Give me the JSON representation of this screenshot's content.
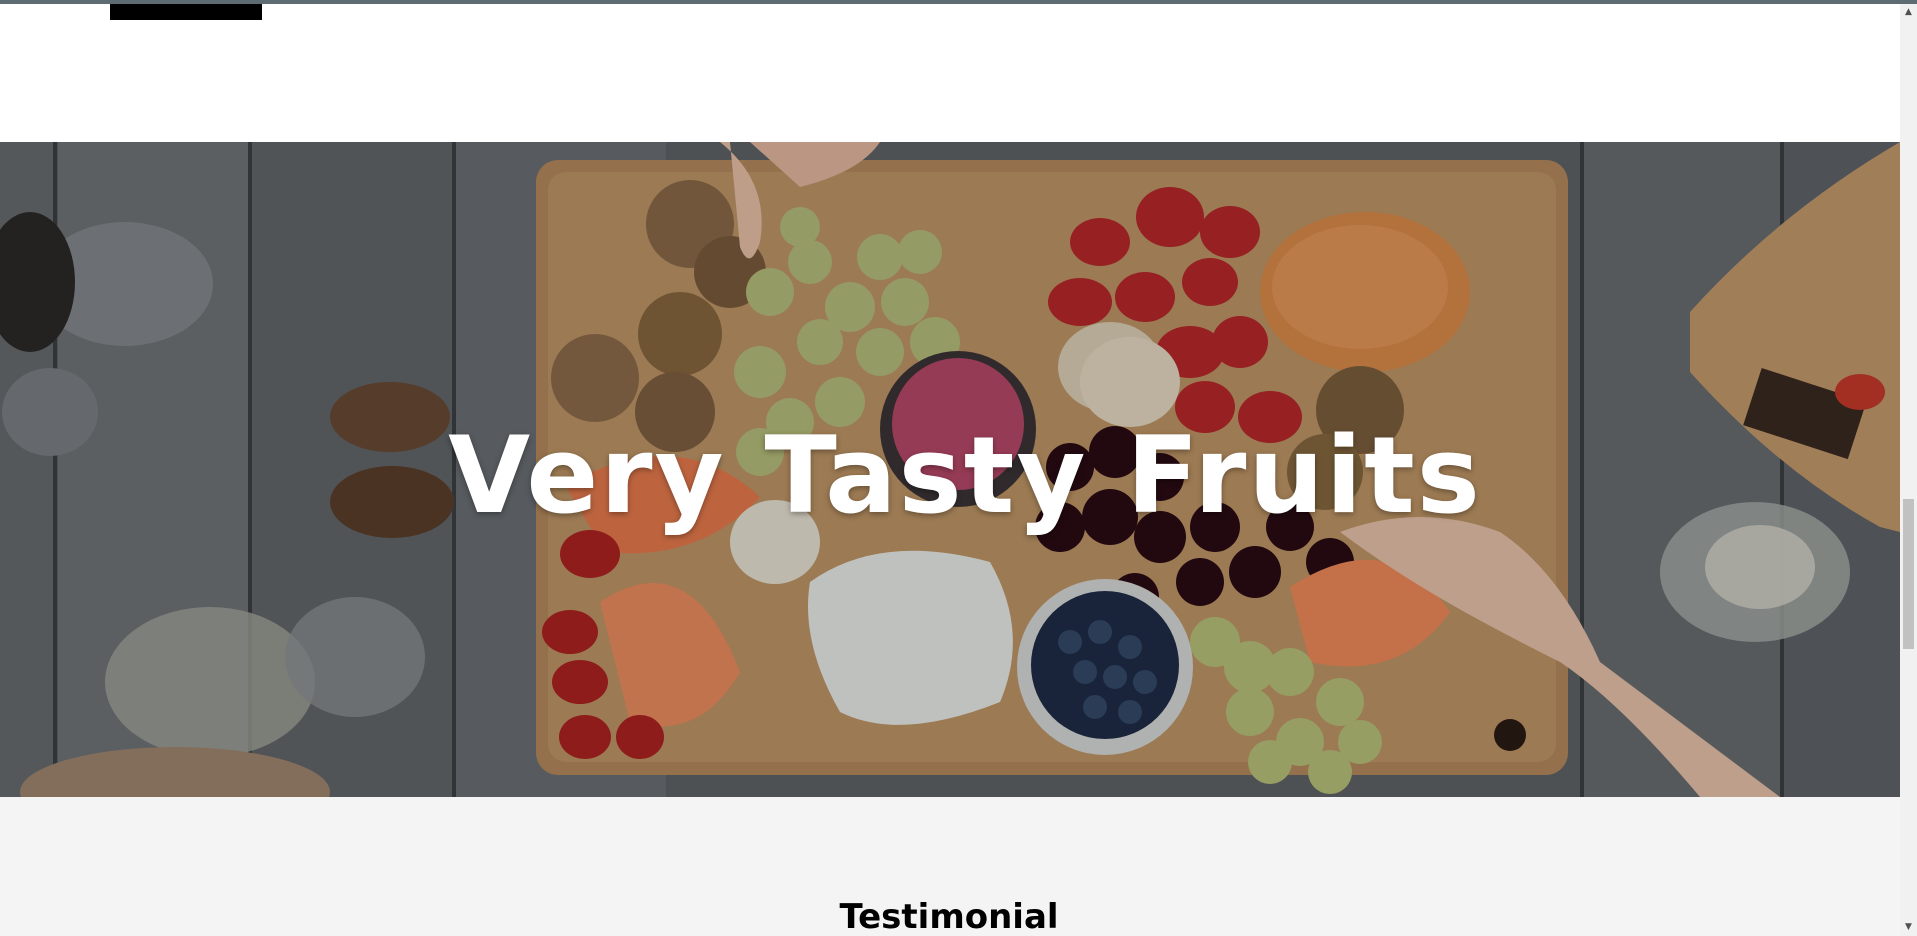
{
  "hero": {
    "title": "Very Tasty Fruits",
    "image_description_icon": "fruit-platter-image"
  },
  "testimonial": {
    "heading": "Testimonial"
  },
  "scrollbar": {
    "up_icon": "▲",
    "down_icon": "▼"
  },
  "colors": {
    "top_border": "#5f6b73",
    "testimonial_bg": "#f4f4f4",
    "hero_text": "#ffffff"
  }
}
